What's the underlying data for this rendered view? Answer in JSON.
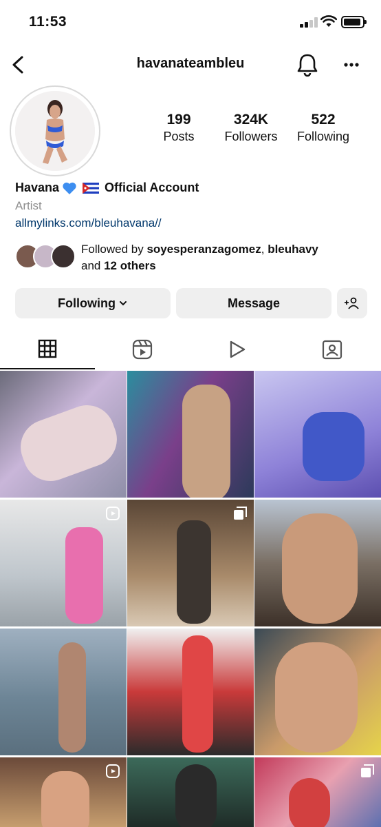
{
  "status_bar": {
    "time": "11:53"
  },
  "header": {
    "username": "havanateambleu"
  },
  "profile": {
    "stats": [
      {
        "value": "199",
        "label": "Posts"
      },
      {
        "value": "324K",
        "label": "Followers"
      },
      {
        "value": "522",
        "label": "Following"
      }
    ],
    "name": "Havana",
    "name_suffix": "Official Account",
    "category": "Artist",
    "link": "allmylinks.com/bleuhavana//",
    "followed_by": {
      "prefix": "Followed by ",
      "user1": "soyesperanzagomez",
      "separator": ", ",
      "user2": "bleuhavy",
      "and": "and ",
      "others": "12 others"
    }
  },
  "buttons": {
    "following_label": "Following",
    "message_label": "Message"
  },
  "tabs": [
    {
      "icon": "grid-icon",
      "active": true
    },
    {
      "icon": "reels-icon",
      "active": false
    },
    {
      "icon": "play-icon",
      "active": false
    },
    {
      "icon": "tagged-icon",
      "active": false
    }
  ],
  "grid": [
    {
      "kind": "photo",
      "badge": ""
    },
    {
      "kind": "photo",
      "badge": ""
    },
    {
      "kind": "photo",
      "badge": ""
    },
    {
      "kind": "reel",
      "badge": "reel-icon"
    },
    {
      "kind": "carousel",
      "badge": "carousel-icon"
    },
    {
      "kind": "photo",
      "badge": ""
    },
    {
      "kind": "photo",
      "badge": ""
    },
    {
      "kind": "photo",
      "badge": ""
    },
    {
      "kind": "photo",
      "badge": ""
    },
    {
      "kind": "reel",
      "badge": "reel-icon"
    },
    {
      "kind": "photo",
      "badge": ""
    },
    {
      "kind": "carousel",
      "badge": "carousel-icon"
    }
  ],
  "colors": {
    "link": "#00376b",
    "button_bg": "#efefef",
    "muted": "#8e8e8e"
  }
}
